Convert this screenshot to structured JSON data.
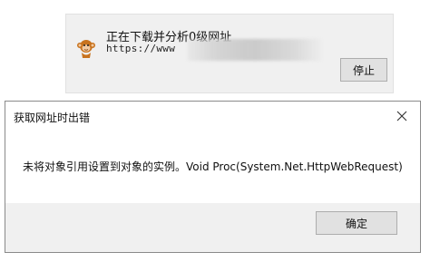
{
  "progress_window": {
    "title": "正在下载并分析0级网址",
    "url_visible": "https://www",
    "url_redacted": true,
    "stop_button_label": "停止",
    "icon": "monkey-icon"
  },
  "error_dialog": {
    "title": "获取网址时出错",
    "message": "未将对象引用设置到对象的实例。Void Proc(System.Net.HttpWebRequest)",
    "ok_button_label": "确定",
    "close_icon": "close-icon"
  }
}
